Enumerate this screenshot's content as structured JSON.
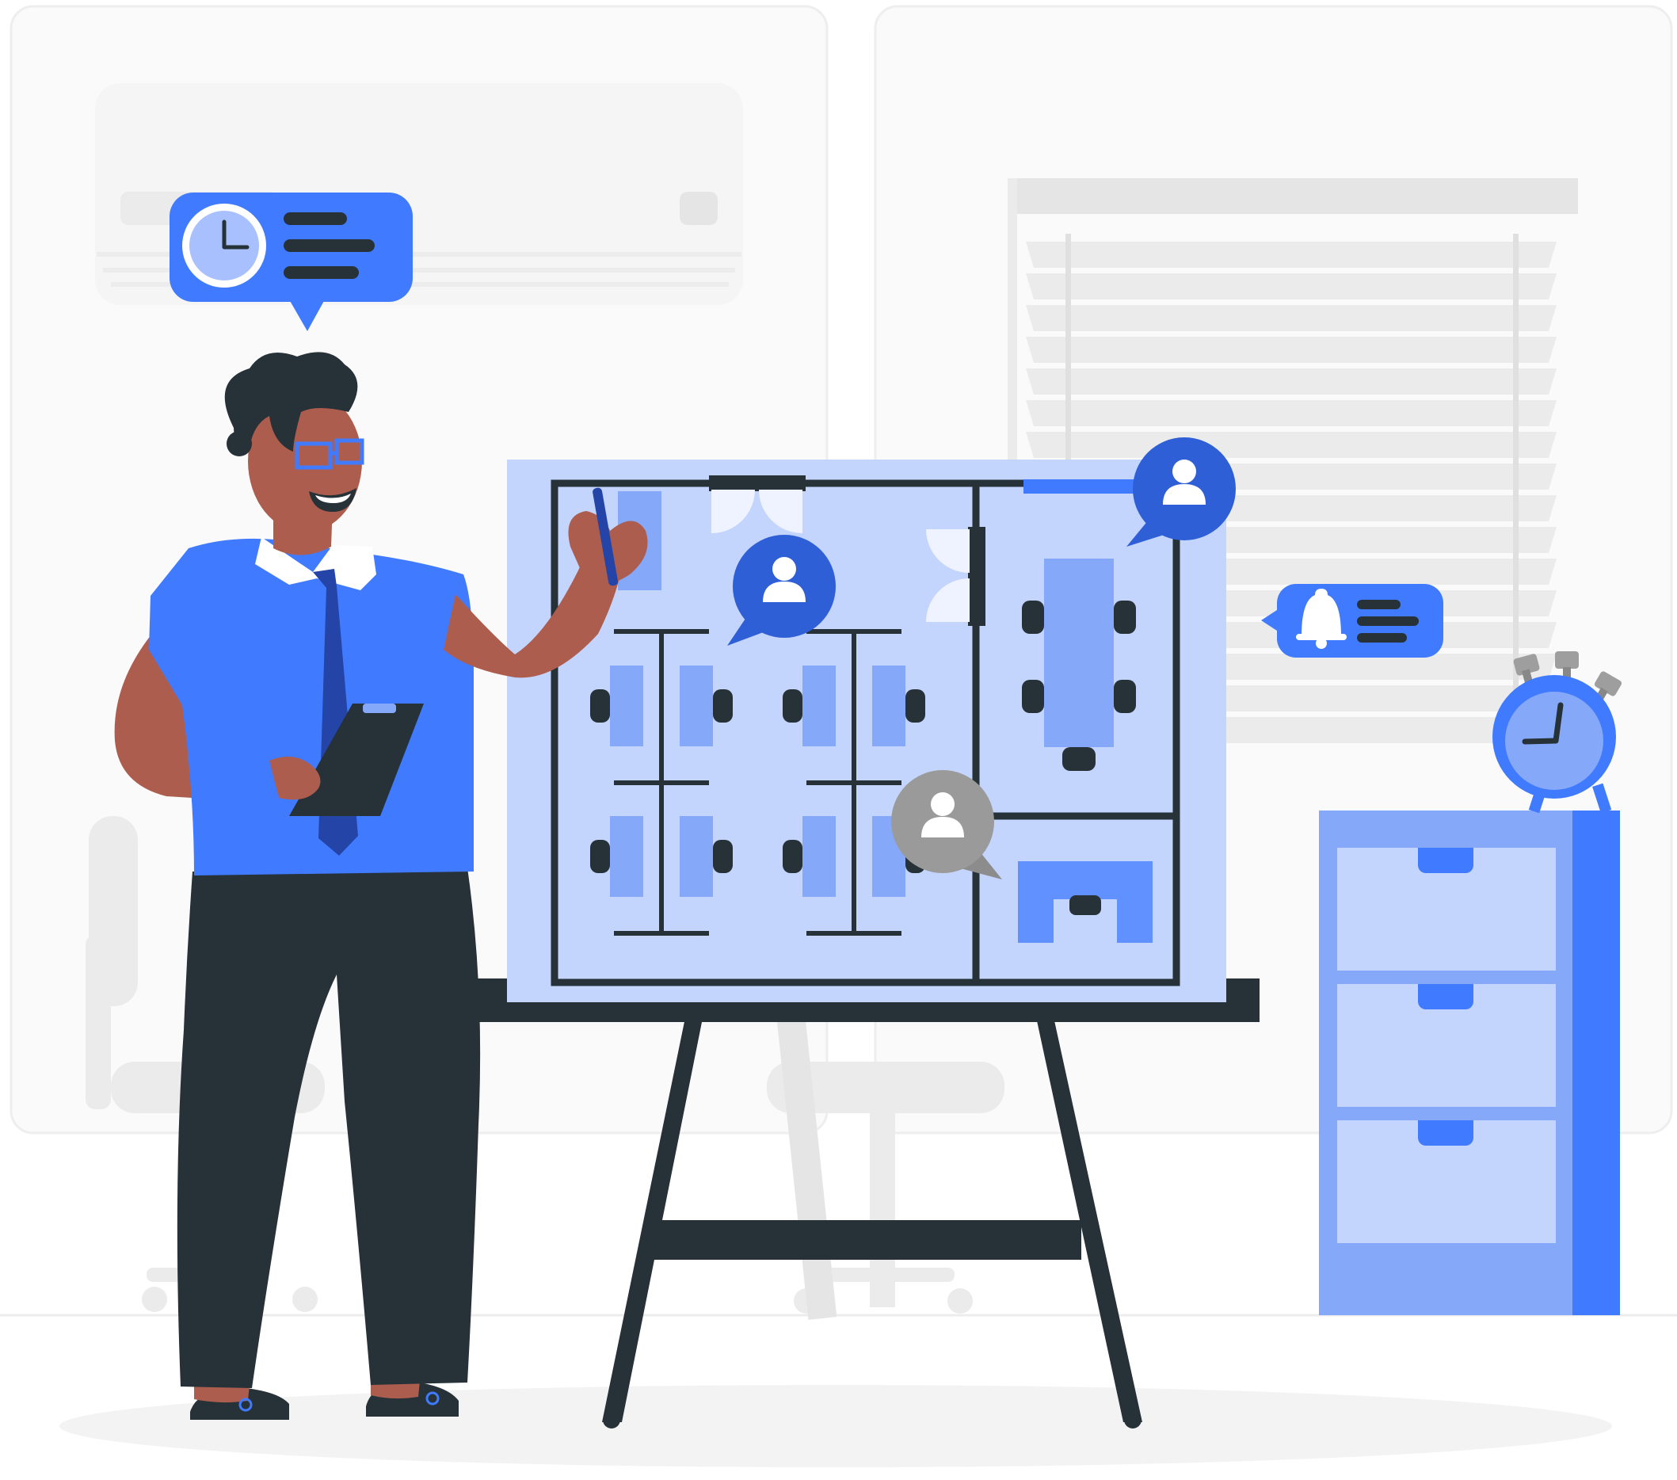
{
  "colors": {
    "primary": "#407bff",
    "primary_dark": "#2f5fd6",
    "plan_bg": "#c3d4fd",
    "plan_mid": "#86a8f8",
    "dark": "#263238",
    "skin": "#ad5d4e",
    "gray_bubble": "#9a9a9a",
    "light_gray": "#ebebeb",
    "lighter_gray": "#f5f5f5"
  },
  "icons": {
    "timer_bubble": "clock-icon",
    "notification_bubble": "bell-icon",
    "person_markers": [
      "user-icon",
      "user-icon",
      "user-icon"
    ],
    "desk_clock": "alarm-clock-icon"
  }
}
